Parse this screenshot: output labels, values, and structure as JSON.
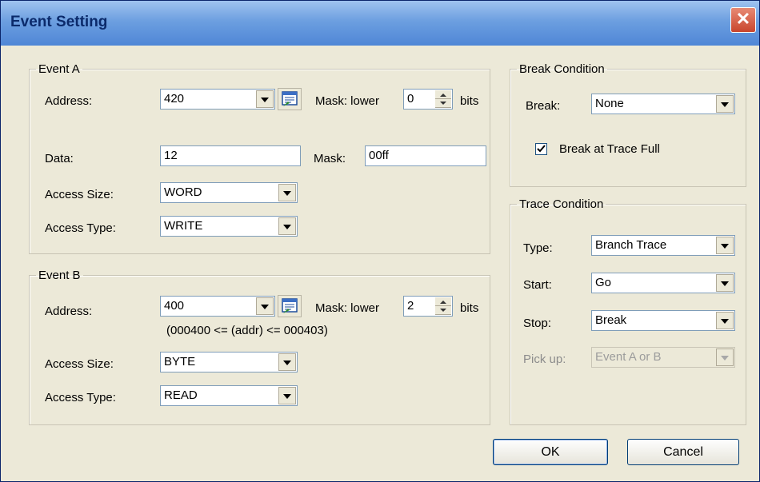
{
  "window": {
    "title": "Event Setting",
    "close_glyph": "✕"
  },
  "event_a": {
    "legend": "Event A",
    "address_label": "Address:",
    "address_value": "420",
    "mask_label": "Mask: lower",
    "mask_value": "0",
    "bits_label": "bits",
    "data_label": "Data:",
    "data_value": "12",
    "data_mask_label": "Mask:",
    "data_mask_value": "00ff",
    "access_size_label": "Access Size:",
    "access_size_value": "WORD",
    "access_type_label": "Access Type:",
    "access_type_value": "WRITE"
  },
  "event_b": {
    "legend": "Event B",
    "address_label": "Address:",
    "address_value": "400",
    "mask_label": "Mask: lower",
    "mask_value": "2",
    "bits_label": "bits",
    "range_text": "(000400 <= (addr) <= 000403)",
    "access_size_label": "Access Size:",
    "access_size_value": "BYTE",
    "access_type_label": "Access Type:",
    "access_type_value": "READ"
  },
  "break_condition": {
    "legend": "Break Condition",
    "break_label": "Break:",
    "break_value": "None",
    "trace_full_label": "Break at Trace Full",
    "trace_full_checked": true
  },
  "trace_condition": {
    "legend": "Trace Condition",
    "type_label": "Type:",
    "type_value": "Branch Trace",
    "start_label": "Start:",
    "start_value": "Go",
    "stop_label": "Stop:",
    "stop_value": "Break",
    "pickup_label": "Pick up:",
    "pickup_value": "Event A or B",
    "pickup_enabled": false
  },
  "buttons": {
    "ok": "OK",
    "cancel": "Cancel"
  },
  "icons": {
    "close": "close-icon",
    "symbol_browser": "symbol-browser-icon",
    "combo_arrow": "chevron-down-icon",
    "spin": "spin-arrows-icon",
    "check": "checkmark-icon"
  },
  "colors": {
    "dialog_bg": "#ece9d8",
    "titlebar_blue": "#4f86d6",
    "title_text": "#0b2a6b",
    "close_red": "#c8452d",
    "field_border": "#7f9db9",
    "disabled_text": "#9c9c9c"
  }
}
